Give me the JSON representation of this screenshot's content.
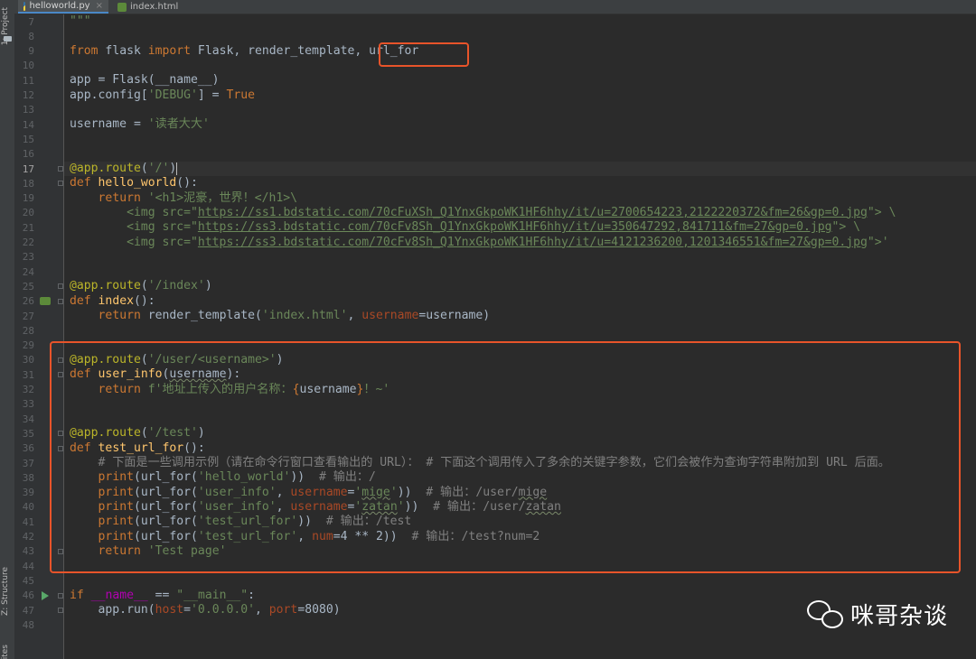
{
  "sidebar": {
    "project_label": "1: Project",
    "structure_label": "Z: Structure",
    "favorites_label": "ites"
  },
  "tabs": [
    {
      "label": "helloworld.py",
      "active": true
    },
    {
      "label": "index.html",
      "active": false
    }
  ],
  "editor": {
    "current_line": 17,
    "lines": [
      {
        "n": 7,
        "html": "<span class=\"str\">\"\"\"</span>"
      },
      {
        "n": 8,
        "html": ""
      },
      {
        "n": 9,
        "html": "<span class=\"kw\">from</span> flask <span class=\"kw\">import</span> Flask, render_template, url_for"
      },
      {
        "n": 10,
        "html": ""
      },
      {
        "n": 11,
        "html": "app = Flask(__name__)"
      },
      {
        "n": 12,
        "html": "app.config[<span class=\"str\">'DEBUG'</span>] = <span class=\"kw\">True</span>"
      },
      {
        "n": 13,
        "html": ""
      },
      {
        "n": 14,
        "html": "username = <span class=\"str\">'读者大大'</span>"
      },
      {
        "n": 15,
        "html": ""
      },
      {
        "n": 16,
        "html": ""
      },
      {
        "n": 17,
        "html": "<span class=\"dec\">@app.route</span>(<span class=\"str\">'/'</span>)<span class=\"caret\"></span>"
      },
      {
        "n": 18,
        "html": "<span class=\"kw\">def</span> <span class=\"fn\">hello_world</span>():"
      },
      {
        "n": 19,
        "html": "    <span class=\"kw\">return</span> <span class=\"str\">'&lt;h1&gt;泥豪，世界！&lt;/h1&gt;\\</span>"
      },
      {
        "n": 20,
        "html": "<span class=\"str\">        &lt;img src=\"<span class=\"lnk\">https://ss1.bdstatic.com/70cFuXSh_Q1YnxGkpoWK1HF6hhy/it/u=2700654223,2122220372&amp;fm=26&amp;gp=0.jpg</span>\"&gt; \\</span>"
      },
      {
        "n": 21,
        "html": "<span class=\"str\">        &lt;img src=\"<span class=\"lnk\">https://ss3.bdstatic.com/70cFv8Sh_Q1YnxGkpoWK1HF6hhy/it/u=350647292,841711&amp;fm=27&amp;gp=0.jpg</span>\"&gt; \\</span>"
      },
      {
        "n": 22,
        "html": "<span class=\"str\">        &lt;img src=\"<span class=\"lnk\">https://ss3.bdstatic.com/70cFv8Sh_Q1YnxGkpoWK1HF6hhy/it/u=4121236200,1201346551&amp;fm=27&amp;gp=0.jpg</span>\"&gt;'</span>"
      },
      {
        "n": 23,
        "html": ""
      },
      {
        "n": 24,
        "html": ""
      },
      {
        "n": 25,
        "html": "<span class=\"dec\">@app.route</span>(<span class=\"str\">'/index'</span>)"
      },
      {
        "n": 26,
        "html": "<span class=\"kw\">def</span> <span class=\"fn\">index</span>():"
      },
      {
        "n": 27,
        "html": "    <span class=\"kw\">return</span> render_template(<span class=\"str\">'index.html'</span>, <span class=\"prm\">username</span>=username)"
      },
      {
        "n": 28,
        "html": ""
      },
      {
        "n": 29,
        "html": ""
      },
      {
        "n": 30,
        "html": "<span class=\"dec\">@app.route</span>(<span class=\"str\">'/user/&lt;username&gt;'</span>)"
      },
      {
        "n": 31,
        "html": "<span class=\"kw\">def</span> <span class=\"fn\">user_info</span>(<span class=\"sq\">username</span>):"
      },
      {
        "n": 32,
        "html": "    <span class=\"kw\">return</span> <span class=\"str\">f'地址上传入的用户名称：</span><span class=\"kw\">{</span>username<span class=\"kw\">}</span><span class=\"str\">！~'</span>"
      },
      {
        "n": 33,
        "html": ""
      },
      {
        "n": 34,
        "html": ""
      },
      {
        "n": 35,
        "html": "<span class=\"dec\">@app.route</span>(<span class=\"str\">'/test'</span>)"
      },
      {
        "n": 36,
        "html": "<span class=\"kw\">def</span> <span class=\"fn\">test_url_for</span>():"
      },
      {
        "n": 37,
        "html": "    <span class=\"cm\"># 下面是一些调用示例（请在命令行窗口查看输出的 URL）： # 下面这个调用传入了多余的关键字参数，它们会被作为查询字符串附加到 URL 后面。</span>"
      },
      {
        "n": 38,
        "html": "    <span class=\"kw\">print</span>(url_for(<span class=\"str\">'hello_world'</span>))  <span class=\"cm\"># 输出：/</span>"
      },
      {
        "n": 39,
        "html": "    <span class=\"kw\">print</span>(url_for(<span class=\"str\">'user_info'</span>, <span class=\"prm\">username</span>=<span class=\"str\">'<span class=\"sq\">mige</span>'</span>))  <span class=\"cm\"># 输出：/user/<span class=\"sq\">mige</span></span>"
      },
      {
        "n": 40,
        "html": "    <span class=\"kw\">print</span>(url_for(<span class=\"str\">'user_info'</span>, <span class=\"prm\">username</span>=<span class=\"str\">'<span class=\"sq\">zatan</span>'</span>))  <span class=\"cm\"># 输出：/user/<span class=\"sq\">zatan</span></span>"
      },
      {
        "n": 41,
        "html": "    <span class=\"kw\">print</span>(url_for(<span class=\"str\">'test_url_for'</span>))  <span class=\"cm\"># 输出：/test</span>"
      },
      {
        "n": 42,
        "html": "    <span class=\"kw\">print</span>(url_for(<span class=\"str\">'test_url_for'</span>, <span class=\"prm\">num</span>=4 ** 2))  <span class=\"cm\"># 输出：/test?num=2</span>"
      },
      {
        "n": 43,
        "html": "    <span class=\"kw\">return</span> <span class=\"str\">'Test page'</span>"
      },
      {
        "n": 44,
        "html": ""
      },
      {
        "n": 45,
        "html": ""
      },
      {
        "n": 46,
        "html": "<span class=\"kw\">if</span> <span class=\"dun\">__name__</span> == <span class=\"str\">\"__main__\"</span>:"
      },
      {
        "n": 47,
        "html": "    app.run(<span class=\"prm\">host</span>=<span class=\"str\">'0.0.0.0'</span>, <span class=\"prm\">port</span>=8080)"
      },
      {
        "n": 48,
        "html": ""
      }
    ]
  },
  "watermark": {
    "text": "咪哥杂谈"
  },
  "colors": {
    "highlight_box": "#e8542a",
    "editor_bg": "#2b2b2b",
    "keyword": "#cc7832",
    "string": "#6a8759",
    "decorator": "#bbb529"
  }
}
